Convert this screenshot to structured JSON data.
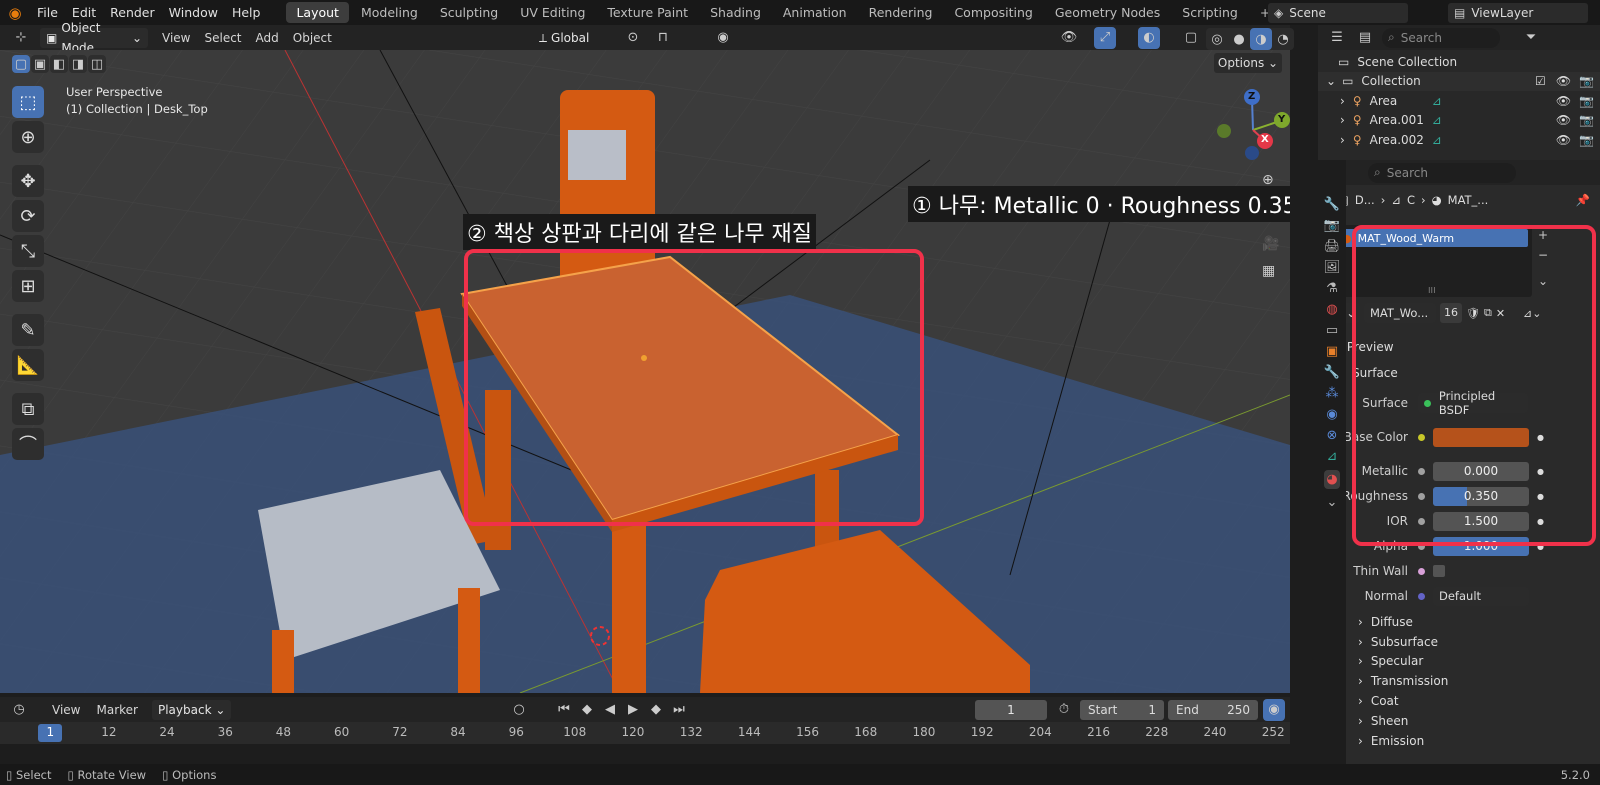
{
  "topbar": {
    "menus": [
      "File",
      "Edit",
      "Render",
      "Window",
      "Help"
    ],
    "workspaces": [
      "Layout",
      "Modeling",
      "Sculpting",
      "UV Editing",
      "Texture Paint",
      "Shading",
      "Animation",
      "Rendering",
      "Compositing",
      "Geometry Nodes",
      "Scripting"
    ],
    "add_tab": "+",
    "scene": "Scene",
    "view_layer": "ViewLayer"
  },
  "viewport_header": {
    "mode": "Object Mode",
    "menus": [
      "View",
      "Select",
      "Add",
      "Object"
    ],
    "orientation": "Global",
    "options": "Options"
  },
  "overlay": {
    "perspective": "User Perspective",
    "object_info": "(1) Collection | Desk_Top"
  },
  "gizmo": {
    "z": "Z",
    "y": "Y",
    "x": "X"
  },
  "annotations": {
    "label1": "① 나무: Metallic 0 · Roughness 0.35",
    "label2": "② 책상 상판과 다리에 같은 나무 재질"
  },
  "outliner": {
    "search_placeholder": "Search",
    "scene_collection": "Scene Collection",
    "collection": "Collection",
    "items": [
      "Area",
      "Area.001",
      "Area.002"
    ]
  },
  "properties": {
    "search_placeholder": "Search",
    "breadcrumb": [
      "D...",
      "C",
      "MAT_..."
    ],
    "material_slot": "MAT_Wood_Warm",
    "material_name": "MAT_Wo...",
    "users": "16",
    "sections": {
      "preview": "Preview",
      "surface": "Surface"
    },
    "surface_label": "Surface",
    "surface_value": "Principled BSDF",
    "rows": [
      {
        "label": "Base Color",
        "type": "color",
        "color": "#b5521b"
      },
      {
        "label": "Metallic",
        "value": "0.000",
        "fill": 0
      },
      {
        "label": "Roughness",
        "value": "0.350",
        "fill": 0.35
      },
      {
        "label": "IOR",
        "value": "1.500",
        "fill": 0
      }
    ],
    "alpha": {
      "label": "Alpha",
      "value": "1.000"
    },
    "thin_wall": {
      "label": "Thin Wall"
    },
    "normal": {
      "label": "Normal",
      "value": "Default"
    },
    "subsections": [
      "Diffuse",
      "Subsurface",
      "Specular",
      "Transmission",
      "Coat",
      "Sheen",
      "Emission"
    ]
  },
  "timeline": {
    "menus": [
      "View",
      "Marker",
      "Playback"
    ],
    "current_frame": "1",
    "start_label": "Start",
    "start": "1",
    "end_label": "End",
    "end": "250",
    "ticks": [
      "1",
      "12",
      "24",
      "36",
      "48",
      "60",
      "72",
      "84",
      "96",
      "108",
      "120",
      "132",
      "144",
      "156",
      "168",
      "180",
      "192",
      "204",
      "216",
      "228",
      "240",
      "252"
    ]
  },
  "statusbar": {
    "select": "Select",
    "rotate": "Rotate View",
    "options": "Options",
    "version": "5.2.0"
  },
  "colors": {
    "accent": "#4772b3",
    "highlight": "#f0314a",
    "wood": "#d45a12"
  }
}
